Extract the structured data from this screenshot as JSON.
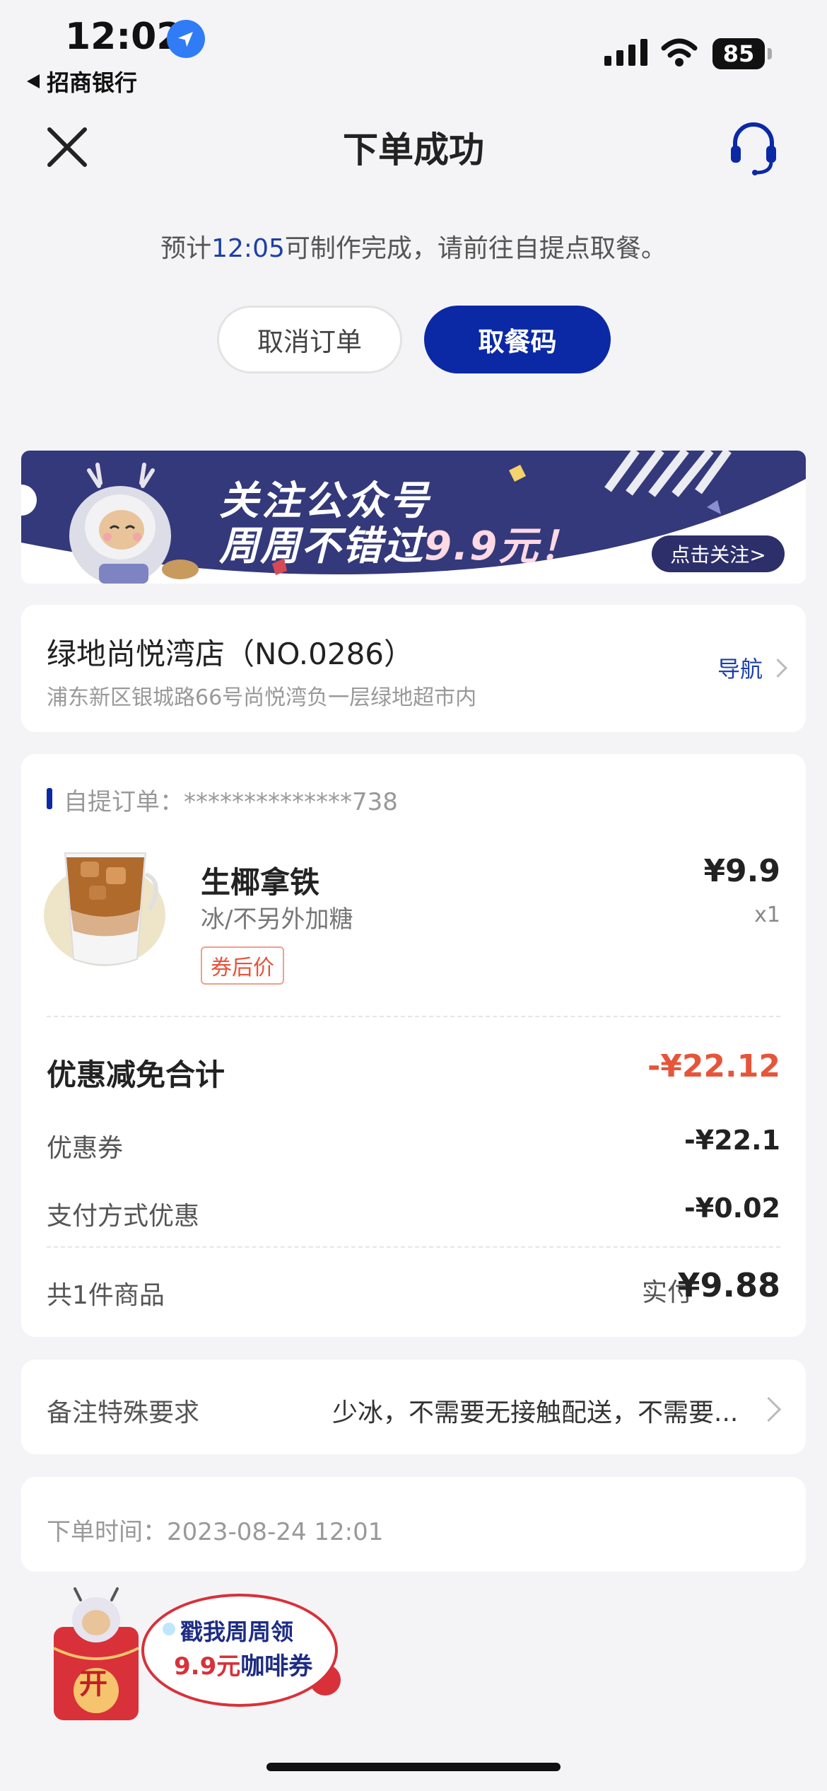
{
  "status_bar": {
    "time": "12:02",
    "back_app": "招商银行",
    "battery": "85"
  },
  "nav": {
    "title": "下单成功"
  },
  "eta": {
    "prefix": "预计",
    "time": "12:05",
    "suffix": "可制作完成，请前往自提点取餐。"
  },
  "actions": {
    "cancel_label": "取消订单",
    "code_label": "取餐码"
  },
  "banner": {
    "line1": "关注公众号",
    "line2_prefix": "周周不错过",
    "line2_highlight": "9.9元！",
    "cta": "点击关注>"
  },
  "store": {
    "name": "绿地尚悦湾店（NO.0286）",
    "address": "浦东新区银城路66号尚悦湾负一层绿地超市内",
    "nav_label": "导航"
  },
  "order": {
    "label": "自提订单：**************738",
    "item": {
      "name": "生椰拿铁",
      "spec": "冰/不另外加糖",
      "tag": "券后价",
      "price": "¥9.9",
      "qty": "x1"
    },
    "discount_title": "优惠减免合计",
    "discount_total": "-¥22.12",
    "rows": [
      {
        "label": "优惠券",
        "value": "-¥22.1"
      },
      {
        "label": "支付方式优惠",
        "value": "-¥0.02"
      }
    ],
    "count_label": "共1件商品",
    "paid_label": "实付",
    "paid_value": "¥9.88"
  },
  "remark": {
    "label": "备注特殊要求",
    "value": "少冰，不需要无接触配送，不需要..."
  },
  "order_time": {
    "text": "下单时间：2023-08-24 12:01"
  },
  "promo": {
    "line1": "戳我周周领",
    "line2_highlight": "9.9元",
    "line2_suffix": "咖啡券",
    "badge": "开"
  },
  "colors": {
    "primary": "#0b29a5",
    "accent_red": "#e6553a",
    "banner_navy": "#33397a"
  }
}
